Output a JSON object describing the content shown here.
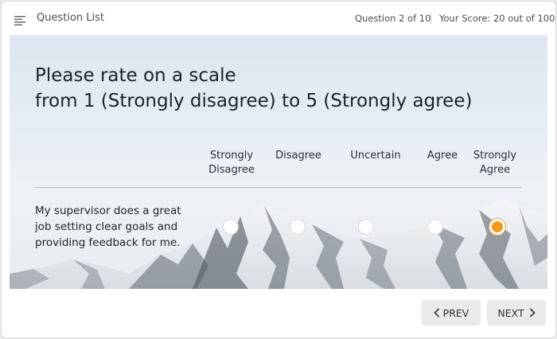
{
  "header": {
    "menu_icon": "hamburger-list-icon",
    "menu_label": "Question List",
    "question_counter": "Question 2 of 10",
    "score": "Your Score: 20 out of 100"
  },
  "question": {
    "line1": "Please rate on a scale",
    "line2": "from 1 (Strongly disagree) to 5 (Strongly agree)",
    "scale": [
      {
        "line1": "Strongly",
        "line2": "Disagree"
      },
      {
        "line1": "Disagree",
        "line2": ""
      },
      {
        "line1": "Uncertain",
        "line2": ""
      },
      {
        "line1": "Agree",
        "line2": ""
      },
      {
        "line1": "Strongly",
        "line2": "Agree"
      }
    ],
    "statement": "My supervisor does a great job setting clear goals and providing feedback for me.",
    "selected_index": 4
  },
  "footer": {
    "prev_label": "PREV",
    "next_label": "NEXT"
  },
  "colors": {
    "accent": "#f39a1c",
    "button_bg": "#e9eaec"
  }
}
